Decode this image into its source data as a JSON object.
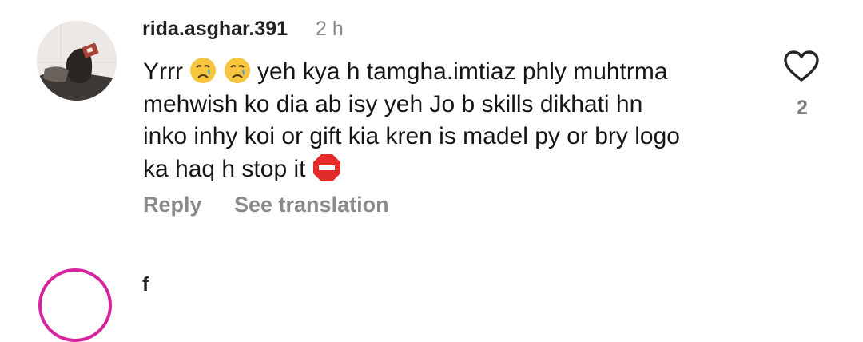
{
  "comment": {
    "username": "rida.asghar.391",
    "time": "2 h",
    "text_line1_start": "Yrrr",
    "text_line1_end": "yeh kya h tamgha.imtiaz phly muhtrma",
    "text_line2": "mehwish ko dia ab isy yeh Jo b skills dikhati hn",
    "text_line3": "inko inhy koi or gift kia kren is madel py or bry logo",
    "text_line4": "ka haq h stop it",
    "emojis": [
      "crying-face",
      "crying-face",
      "stop-sign"
    ],
    "like_count": "2",
    "reply_label": "Reply",
    "translation_label": "See translation"
  },
  "next_comment": {
    "username_partial": "f"
  },
  "colors": {
    "username": "#222222",
    "meta": "#8a8a8a",
    "text": "#151515",
    "story_ring": "#d6249f"
  }
}
